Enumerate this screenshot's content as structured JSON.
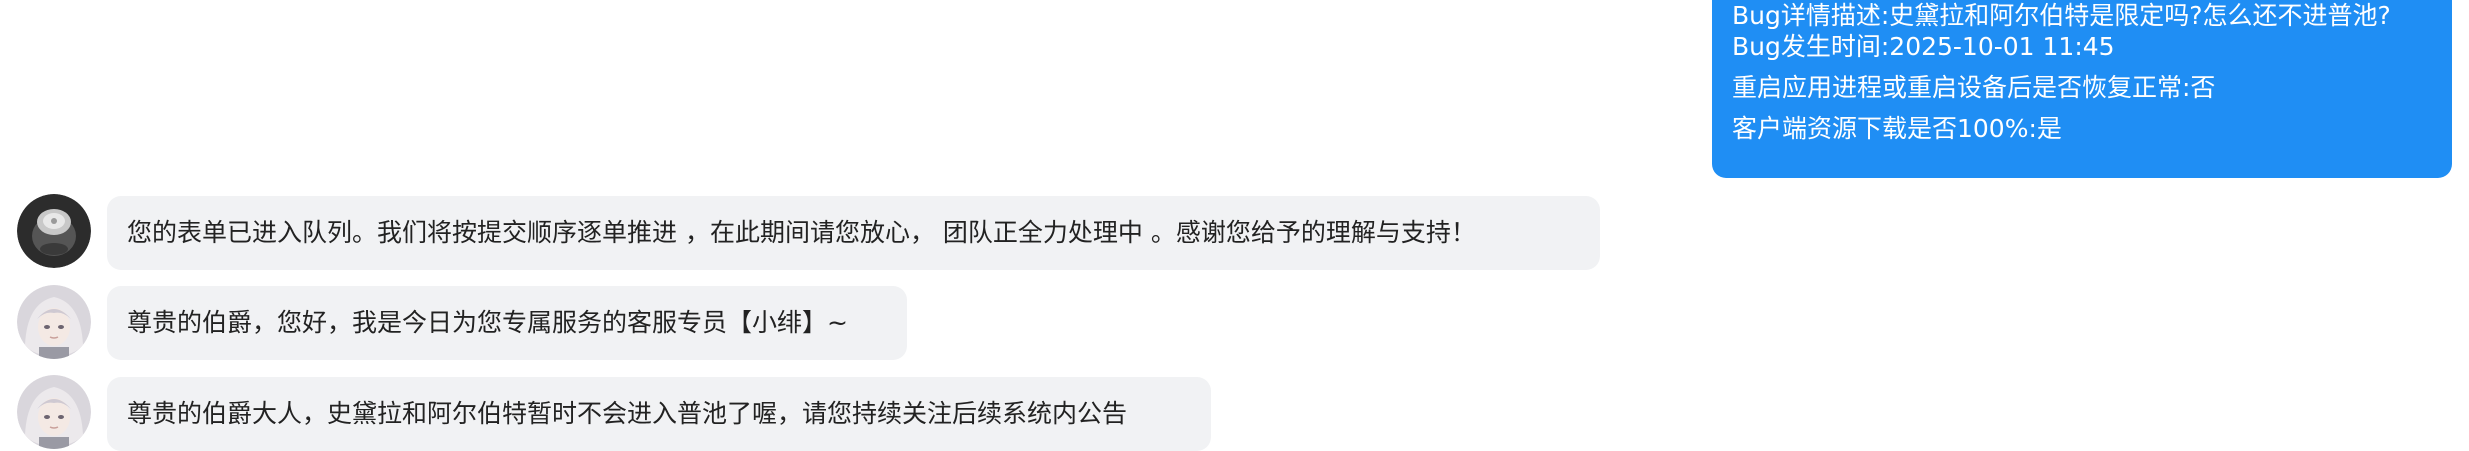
{
  "user_message": {
    "lines": [
      "Bug详情描述:史黛拉和阿尔伯特是限定吗?怎么还不进普池?",
      "Bug发生时间:2025-10-01 11:45",
      "重启应用进程或重启设备后是否恢复正常:否",
      "客户端资源下载是否100%:是"
    ]
  },
  "messages": [
    {
      "avatar_icon": "system-bot-avatar",
      "text": "您的表单已进入队列。我们将按提交顺序逐单推进    ，在此期间请您放心，  团队正全力处理中   。感谢您给予的理解与支持！"
    },
    {
      "avatar_icon": "agent-avatar",
      "text": "尊贵的伯爵，您好，我是今日为您专属服务的客服专员【小绯】~"
    },
    {
      "avatar_icon": "agent-avatar",
      "text": "尊贵的伯爵大人，史黛拉和阿尔伯特暂时不会进入普池了喔，请您持续关注后续系统内公告"
    }
  ],
  "colors": {
    "user_bubble": "#1f8ef4",
    "incoming_bubble": "#f1f2f4"
  }
}
